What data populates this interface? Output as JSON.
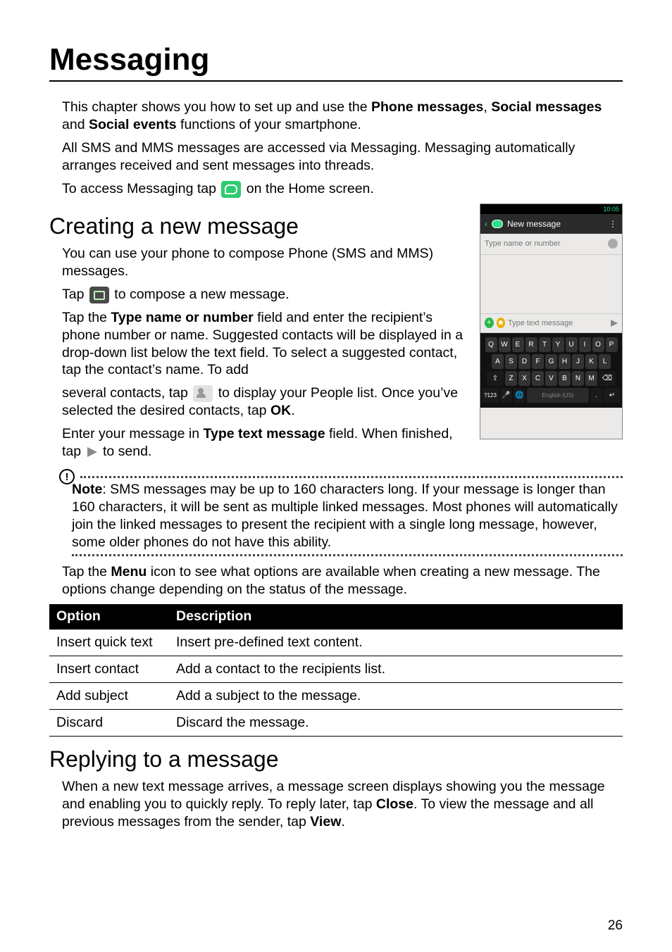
{
  "title": "Messaging",
  "intro1_a": "This chapter shows you how to set up and use the ",
  "intro1_b": "Phone messages",
  "intro1_c": ", ",
  "intro1_d": "Social messages",
  "intro1_e": " and ",
  "intro1_f": "Social events",
  "intro1_g": " functions of your smartphone.",
  "intro2": "All SMS and MMS messages are accessed via Messaging. Messaging automatically arranges received and sent messages into threads.",
  "intro3_a": "To access Messaging tap ",
  "intro3_b": " on the Home screen.",
  "h2_create": "Creating a new message",
  "create_p1": "You can use your phone to compose Phone (SMS and MMS) messages.",
  "create_p2_a": "Tap ",
  "create_p2_b": " to compose a new message.",
  "create_p3_a": "Tap the ",
  "create_p3_b": "Type name or number",
  "create_p3_c": " field and enter the recipient’s phone number or name. Suggested contacts will be displayed in a drop-down list below the text field. To select a suggested contact, tap the contact’s name. To add ",
  "create_p4_a": "several contacts, tap ",
  "create_p4_b": " to display your People list. Once you’ve selected the desired contacts, tap ",
  "create_p4_c": "OK",
  "create_p4_d": ".",
  "create_p5_a": "Enter your message in ",
  "create_p5_b": "Type text message",
  "create_p5_c": " field. When finished, tap ",
  "create_p5_d": " to send.",
  "note_label": "Note",
  "note_text": ": SMS messages may be up to 160 characters long. If your message is longer than 160 characters, it will be sent as multiple linked messages. Most phones will automatically join the linked messages to present the recipient with a single long message, however, some older phones do not have this ability.",
  "menu_p_a": "Tap the ",
  "menu_p_b": "Menu",
  "menu_p_c": " icon to see what options are available when creating a new message. The options change depending on the status of the message.",
  "table": {
    "col1": "Option",
    "col2": "Description",
    "rows": [
      {
        "option": "Insert quick text",
        "desc": "Insert pre-defined text content."
      },
      {
        "option": "Insert contact",
        "desc": "Add a contact to the recipients list."
      },
      {
        "option": "Add subject",
        "desc": "Add a subject to the message."
      },
      {
        "option": "Discard",
        "desc": "Discard the message."
      }
    ]
  },
  "h2_reply": "Replying to a message",
  "reply_p_a": "When a new text message arrives, a message screen displays showing you the message and enabling you to quickly reply. To reply later, tap ",
  "reply_p_b": "Close",
  "reply_p_c": ". To view the message and all previous messages from the sender, tap ",
  "reply_p_d": "View",
  "reply_p_e": ".",
  "page_number": "26",
  "phone": {
    "status_left": "",
    "time": "10:05",
    "header_title": "New message",
    "input_top_placeholder": "Type name or number",
    "textinput_placeholder": "Type text message",
    "keyboard": {
      "row1": [
        "Q",
        "W",
        "E",
        "R",
        "T",
        "Y",
        "U",
        "I",
        "O",
        "P"
      ],
      "row2": [
        "A",
        "S",
        "D",
        "F",
        "G",
        "H",
        "J",
        "K",
        "L"
      ],
      "row3_shift": "⇧",
      "row3": [
        "Z",
        "X",
        "C",
        "V",
        "B",
        "N",
        "M"
      ],
      "row3_back": "⌫",
      "row4_sym": "?123",
      "row4_mic": "🎤",
      "row4_globe": "🌐",
      "row4_space": "English (US)",
      "row4_dot": ".",
      "row4_enter": "↵"
    }
  }
}
